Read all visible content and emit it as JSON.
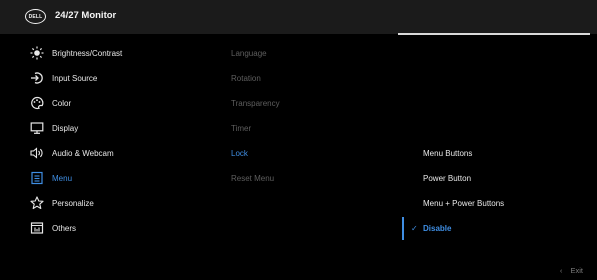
{
  "header": {
    "logo_text": "DELL",
    "title": "24/27 Monitor"
  },
  "main_menu": [
    {
      "label": "Brightness/Contrast",
      "icon": "brightness-icon"
    },
    {
      "label": "Input Source",
      "icon": "input-source-icon"
    },
    {
      "label": "Color",
      "icon": "color-icon"
    },
    {
      "label": "Display",
      "icon": "display-icon"
    },
    {
      "label": "Audio & Webcam",
      "icon": "audio-icon"
    },
    {
      "label": "Menu",
      "icon": "menu-icon",
      "active": true
    },
    {
      "label": "Personalize",
      "icon": "star-icon"
    },
    {
      "label": "Others",
      "icon": "others-icon"
    }
  ],
  "submenu": [
    {
      "label": "Language"
    },
    {
      "label": "Rotation"
    },
    {
      "label": "Transparency"
    },
    {
      "label": "Timer"
    },
    {
      "label": "Lock",
      "active": true
    },
    {
      "label": "Reset Menu"
    }
  ],
  "lock_options": [
    {
      "label": "Menu Buttons"
    },
    {
      "label": "Power Button"
    },
    {
      "label": "Menu + Power Buttons"
    },
    {
      "label": "Disable",
      "selected": true
    }
  ],
  "check_glyph": "✓",
  "footer": {
    "exit_label": "Exit",
    "chevron_glyph": "‹"
  },
  "colors": {
    "accent": "#3f8ee3",
    "header_bg": "#1b1b1b",
    "background": "#000000",
    "inactive_text": "#5e5e5e"
  }
}
